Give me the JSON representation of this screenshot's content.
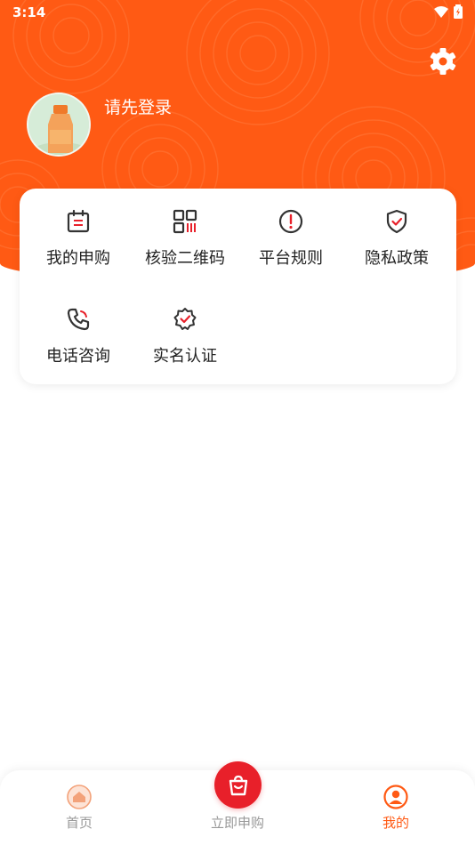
{
  "status_bar": {
    "time": "3:14"
  },
  "profile": {
    "login_prompt": "请先登录"
  },
  "menu": {
    "items": [
      {
        "label": "我的申购",
        "icon": "calendar-icon"
      },
      {
        "label": "核验二维码",
        "icon": "qr-code-icon"
      },
      {
        "label": "平台规则",
        "icon": "alert-circle-icon"
      },
      {
        "label": "隐私政策",
        "icon": "shield-check-icon"
      },
      {
        "label": "电话咨询",
        "icon": "phone-icon"
      },
      {
        "label": "实名认证",
        "icon": "verified-badge-icon"
      }
    ]
  },
  "tabbar": {
    "home": "首页",
    "buy": "立即申购",
    "mine": "我的",
    "active": "mine"
  },
  "colors": {
    "brand_orange": "#ff5a14",
    "buy_red": "#e8202a",
    "icon_dark": "#333333",
    "icon_accent": "#e8202a"
  }
}
